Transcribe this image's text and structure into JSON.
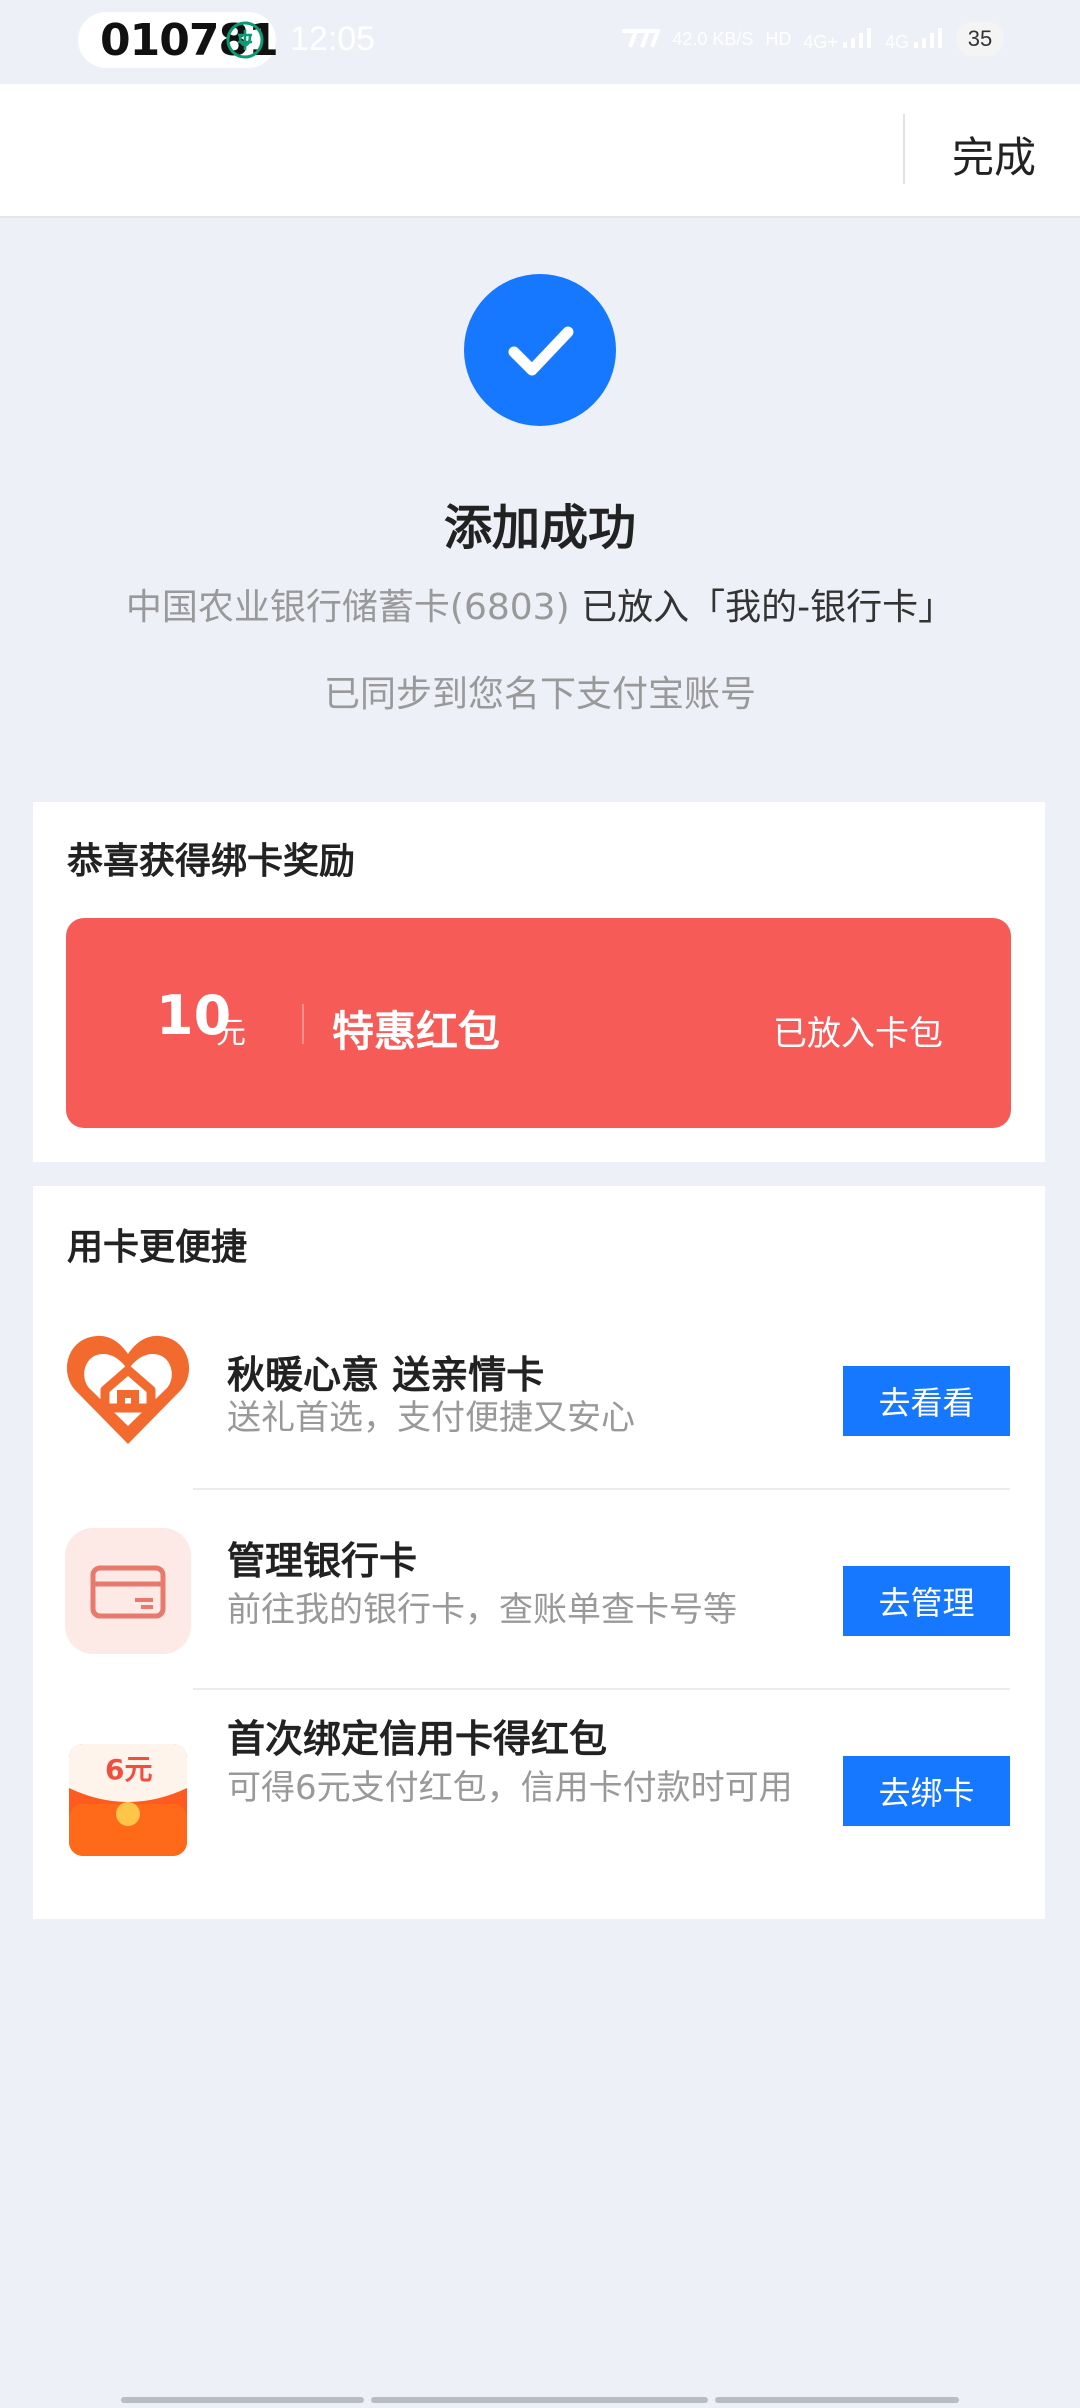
{
  "status_bar": {
    "sms_code": "010781",
    "time": "12:05",
    "net_speed": "42.0 KB/S",
    "hd": "HD",
    "sim1": "4G+",
    "sim2": "4G",
    "battery": "35"
  },
  "nav": {
    "done_label": "完成"
  },
  "success": {
    "title": "添加成功",
    "card_name": "中国农业银行储蓄卡(6803)",
    "placed_text": "已放入「我的-银行卡」",
    "sync_text": "已同步到您名下支付宝账号"
  },
  "reward": {
    "section_title": "恭喜获得绑卡奖励",
    "amount": "10",
    "unit": "元",
    "name": "特惠红包",
    "status": "已放入卡包"
  },
  "quick": {
    "section_title": "用卡更便捷",
    "items": [
      {
        "title": "秋暖心意 送亲情卡",
        "subtitle": "送礼首选，支付便捷又安心",
        "button": "去看看",
        "icon": "heart-home-icon"
      },
      {
        "title": "管理银行卡",
        "subtitle": "前往我的银行卡，查账单查卡号等",
        "button": "去管理",
        "icon": "bank-card-icon"
      },
      {
        "title": "首次绑定信用卡得红包",
        "subtitle": "可得6元支付红包，信用卡付款时可用",
        "button": "去绑卡",
        "icon": "red-envelope-icon",
        "icon_text": "6元"
      }
    ]
  },
  "colors": {
    "primary": "#1677ff",
    "reward_red": "#f65b58",
    "background": "#edf0f6"
  }
}
